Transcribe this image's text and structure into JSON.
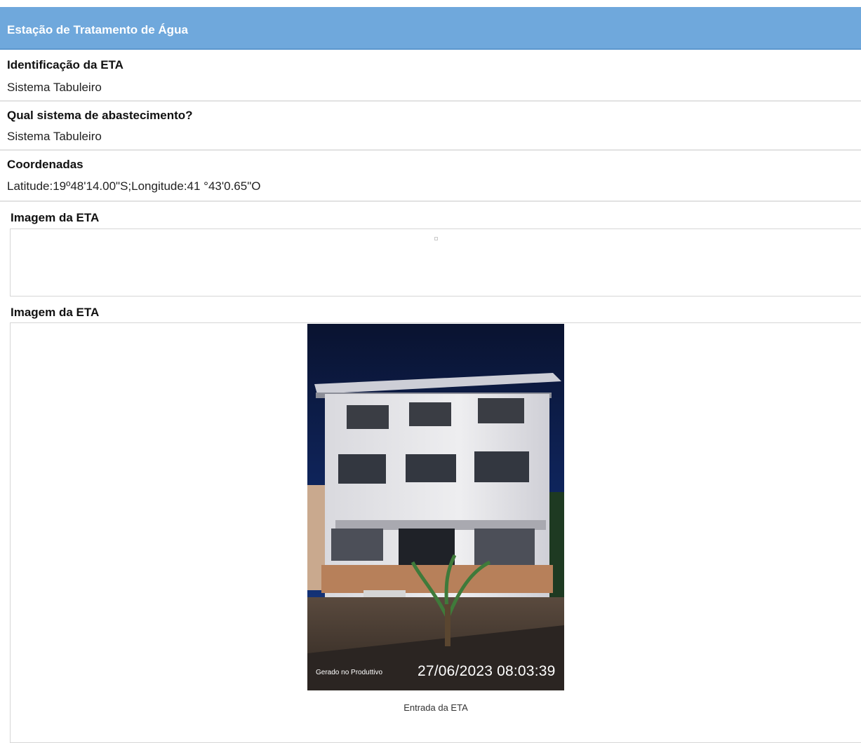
{
  "header": {
    "title": "Estação de Tratamento de Água"
  },
  "fields": [
    {
      "label": "Identificação da ETA",
      "value": "Sistema Tabuleiro"
    },
    {
      "label": "Qual sistema de abastecimento?",
      "value": "Sistema Tabuleiro"
    },
    {
      "label": "Coordenadas",
      "value": "Latitude:19º48'14.00\"S;Longitude:41 °43'0.65\"O"
    }
  ],
  "images": [
    {
      "label": "Imagem da ETA"
    },
    {
      "label": "Imagem da ETA",
      "photo_watermark": "Gerado no Produttivo",
      "photo_timestamp": "27/06/2023 08:03:39",
      "caption": "Entrada da ETA"
    }
  ]
}
